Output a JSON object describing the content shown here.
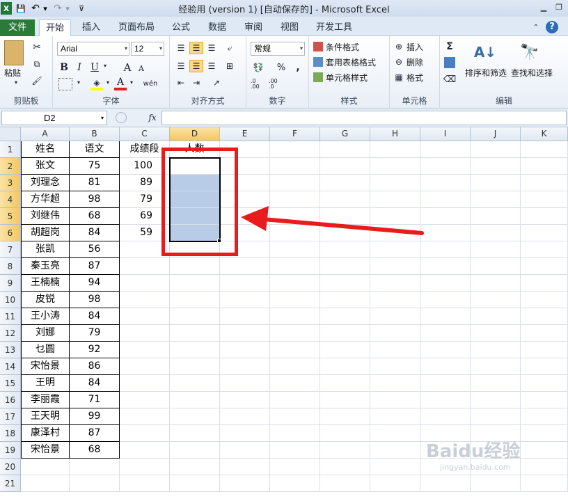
{
  "window": {
    "title": "经验用 (version 1) [自动保存的]  -  Microsoft Excel",
    "controls": [
      "minimize-icon",
      "restore-icon",
      "close-icon"
    ]
  },
  "quick_access": {
    "icons": [
      "excel-logo-icon",
      "save-icon",
      "undo-icon",
      "redo-icon",
      "customize-icon"
    ],
    "undo_glyph": "↶",
    "redo_glyph": "↷",
    "save_glyph": "💾",
    "dropdown_glyph": "▾",
    "customize_glyph": "⊽"
  },
  "tabs": {
    "file": "文件",
    "items": [
      "开始",
      "插入",
      "页面布局",
      "公式",
      "数据",
      "审阅",
      "视图",
      "开发工具"
    ],
    "active": "开始"
  },
  "ribbon": {
    "clipboard": {
      "label": "剪贴板",
      "paste": "粘贴"
    },
    "font": {
      "label": "字体",
      "font_name": "Arial",
      "font_size": "12",
      "bold": "B",
      "italic": "I",
      "underline": "U",
      "grow": "A",
      "shrink": "A",
      "phonetic": "wén"
    },
    "alignment": {
      "label": "对齐方式"
    },
    "number": {
      "label": "数字",
      "format": "常规",
      "percent": "%",
      "comma": ",",
      "increase_decimal": ".0 .00",
      "decrease_decimal": ".00 .0"
    },
    "styles": {
      "label": "样式",
      "conditional": "条件格式",
      "table": "套用表格格式",
      "cell": "单元格样式"
    },
    "cells": {
      "label": "单元格",
      "insert": "插入",
      "delete": "删除",
      "format": "格式"
    },
    "editing": {
      "label": "编辑",
      "sort_filter": "排序和筛选",
      "find_select": "查找和选择",
      "sum": "Σ"
    },
    "colors": {
      "highlight": "#ffff00",
      "font_color": "#e81c1c"
    }
  },
  "formula_bar": {
    "name_box": "D2",
    "fx": "fx",
    "formula": ""
  },
  "sheet": {
    "columns": [
      "A",
      "B",
      "C",
      "D",
      "E",
      "F",
      "G",
      "H",
      "I",
      "J",
      "K"
    ],
    "selected_column": "D",
    "rows": [
      "1",
      "2",
      "3",
      "4",
      "5",
      "6",
      "7",
      "8",
      "9",
      "10",
      "11",
      "12",
      "13",
      "14",
      "15",
      "16",
      "17",
      "18",
      "19",
      "20",
      "21"
    ],
    "selected_rows": [
      "2",
      "3",
      "4",
      "5",
      "6"
    ],
    "header_row": {
      "A": "姓名",
      "B": "语文",
      "C": "成绩段",
      "D": "人数"
    },
    "names": [
      "张文",
      "刘理念",
      "方华超",
      "刘继伟",
      "胡超岗",
      "张凯",
      "秦玉亮",
      "王楠楠",
      "皮锐",
      "王小涛",
      "刘娜",
      "乜圆",
      "宋怡景",
      "王明",
      "李丽霞",
      "王天明",
      "康泽村",
      "宋怡景"
    ],
    "scores": [
      "75",
      "81",
      "98",
      "68",
      "84",
      "56",
      "87",
      "94",
      "98",
      "84",
      "79",
      "92",
      "86",
      "84",
      "71",
      "99",
      "87",
      "68"
    ],
    "score_bands": [
      "100",
      "89",
      "79",
      "69",
      "59"
    ]
  },
  "annotation": {
    "color": "#e81c1c"
  },
  "watermark": {
    "logo": "Baidu经验",
    "url": "jingyan.baidu.com"
  }
}
